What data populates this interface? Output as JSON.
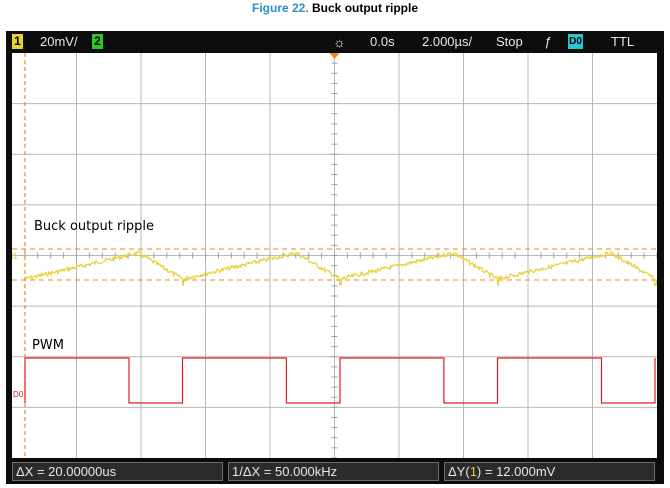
{
  "caption": {
    "figure": "Figure 22.",
    "title": "Buck output ripple"
  },
  "scope": {
    "ch1_number": "1",
    "ch1_scale": "20mV/",
    "ch2_number": "2",
    "time_offset": "0.0s",
    "time_scale": "2.000µs/",
    "run_state": "Stop",
    "trigger_type": "ƒ",
    "trigger_source": "D0",
    "trigger_level": "TTL",
    "colors": {
      "ch1": "#e8d13b",
      "ch2": "#28c828",
      "digital": "#e02020",
      "accent": "#f08a1c"
    }
  },
  "waveforms": {
    "analog_label": "Buck output ripple",
    "digital_label": "PWM",
    "ch1_marker": "1",
    "d0_marker": "D0"
  },
  "measurements": {
    "delta_x": "ΔX = 20.00000us",
    "inv_delta_x": "1/ΔX = 50.000kHz",
    "delta_y_prefix": "ΔY(",
    "delta_y_channel": "1",
    "delta_y_suffix": ") = 12.000mV"
  }
}
